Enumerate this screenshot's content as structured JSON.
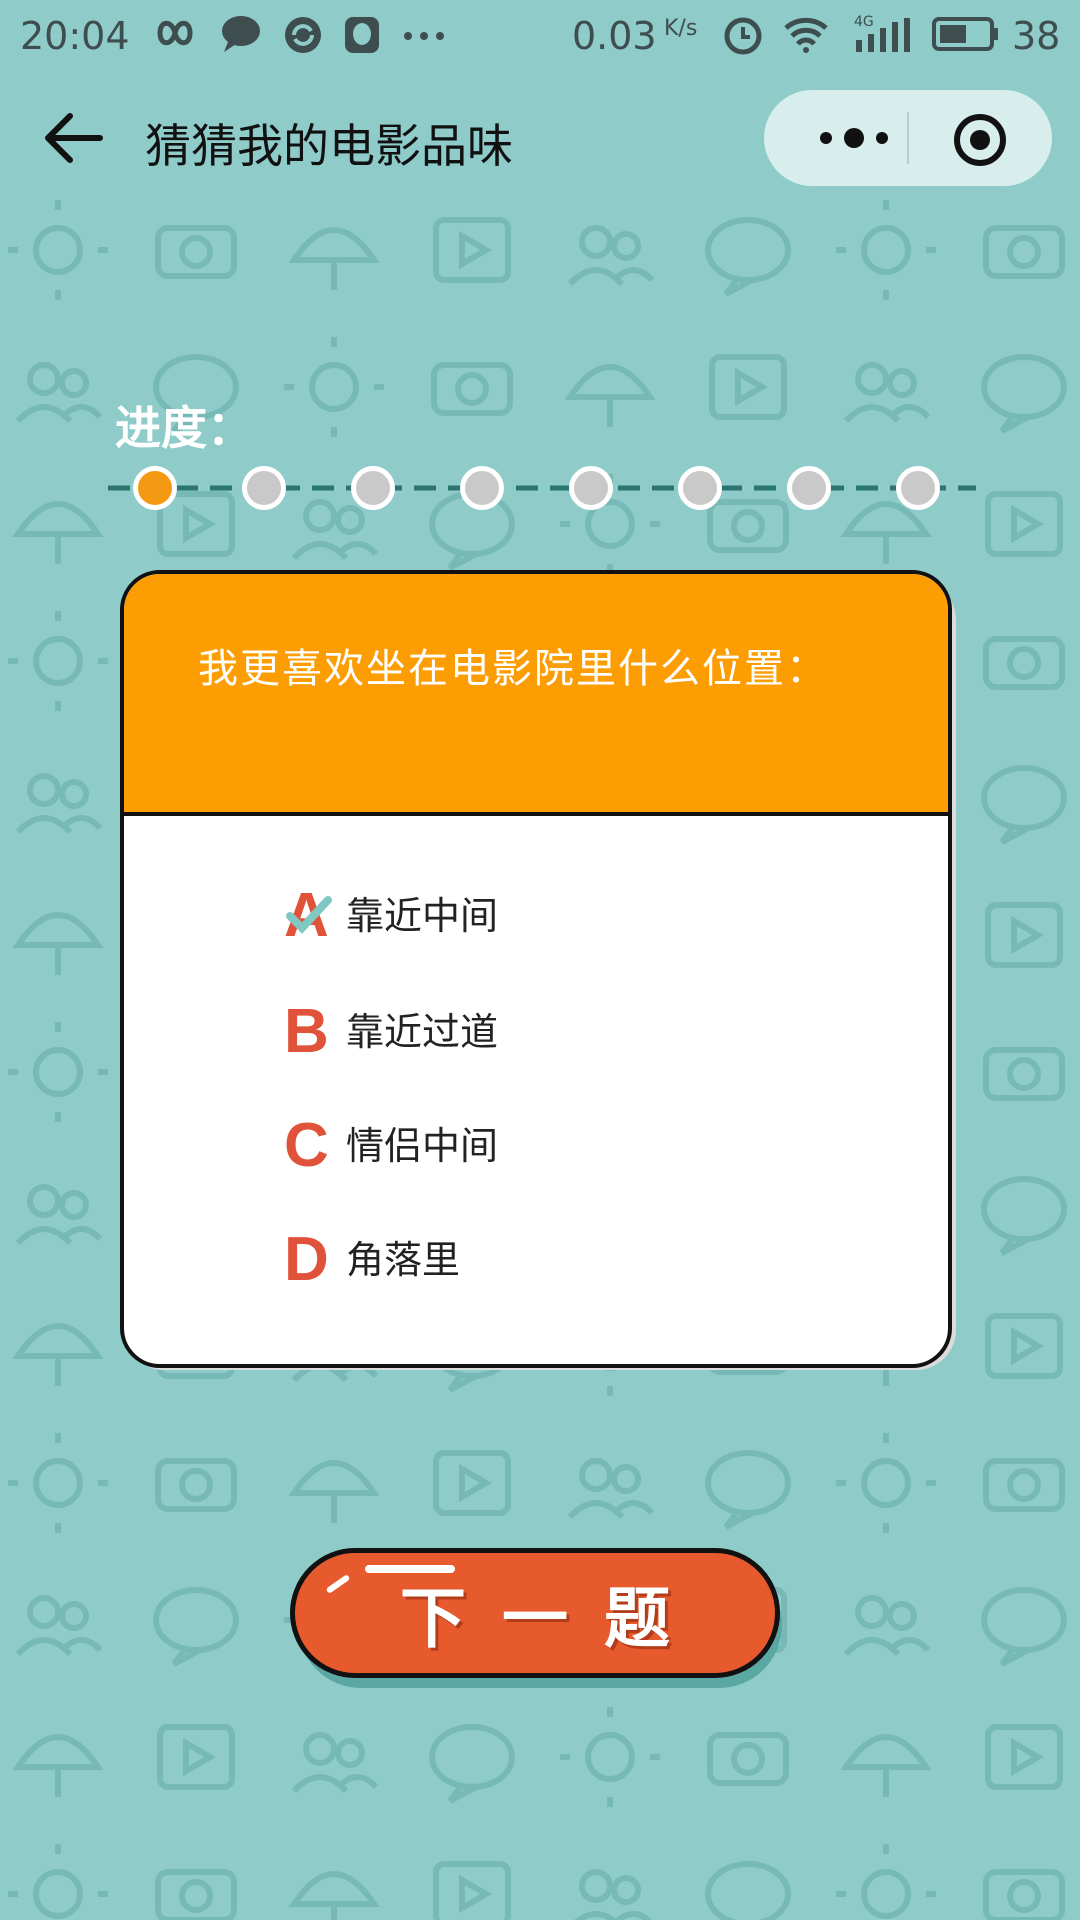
{
  "status_bar": {
    "time": "20:04",
    "net_speed": "0.03",
    "net_unit": "K/s",
    "signal_type": "4G",
    "battery": "38",
    "icons": [
      "infinity-icon",
      "chat-bubble-icon",
      "sync-icon",
      "qq-icon",
      "more-dots-icon",
      "alarm-icon",
      "wifi-icon",
      "signal-icon",
      "battery-icon"
    ]
  },
  "nav": {
    "title": "猜猜我的电影品味",
    "back_icon": "arrow-left-icon",
    "more_icon": "more-dots-icon",
    "close_icon": "target-circle-icon"
  },
  "progress": {
    "label": "进度：",
    "total": 8,
    "current": 1
  },
  "question": {
    "text": "我更喜欢坐在电影院里什么位置：",
    "options": [
      {
        "letter": "A",
        "text": "靠近中间",
        "selected": true
      },
      {
        "letter": "B",
        "text": "靠近过道",
        "selected": false
      },
      {
        "letter": "C",
        "text": "情侣中间",
        "selected": false
      },
      {
        "letter": "D",
        "text": "角落里",
        "selected": false
      }
    ]
  },
  "next_button": {
    "label": "下一题"
  },
  "colors": {
    "background": "#8ecbc9",
    "card_header": "#fc9d04",
    "accent_red": "#e75a2e",
    "option_letter": "#e0533a",
    "check": "#7fc8c4"
  }
}
